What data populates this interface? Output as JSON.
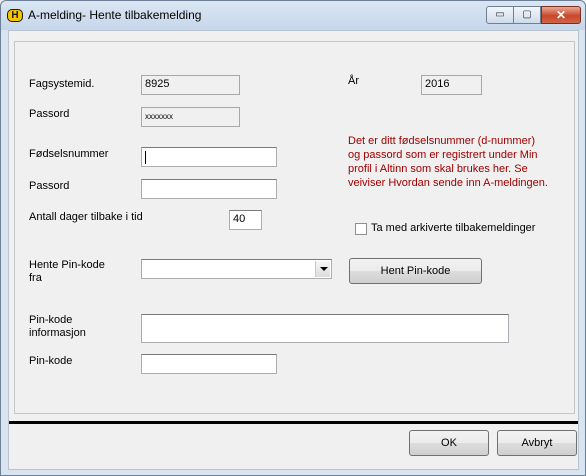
{
  "window": {
    "title": "A-melding- Hente tilbakemelding",
    "app_icon": "H",
    "controls": {
      "minimize": "▭",
      "maximize": "▢",
      "close": "✕"
    }
  },
  "form": {
    "fagsystemid_label": "Fagsystemid.",
    "fagsystemid_value": "8925",
    "ar_label": "År",
    "ar_value": "2016",
    "passord1_label": "Passord",
    "passord1_value": "xxxxxxx",
    "info_text": "Det er ditt fødselsnummer (d-nummer) og passord som er registrert under Min profil i Altinn som skal brukes her. Se veiviser Hvordan sende inn A-meldingen.",
    "fodselsnummer_label": "Fødselsnummer",
    "fodselsnummer_value": "",
    "passord2_label": "Passord",
    "passord2_value": "",
    "antall_dager_label": "Antall dager tilbake i tid",
    "antall_dager_value": "40",
    "arkiverte_label": "Ta med arkiverte tilbakemeldinger",
    "arkiverte_checked": false,
    "hente_pin_label_line1": "Hente Pin-kode",
    "hente_pin_label_line2": "fra",
    "hente_pin_selected": "",
    "hent_pin_button": "Hent Pin-kode",
    "pin_info_label_line1": "Pin-kode",
    "pin_info_label_line2": "informasjon",
    "pin_info_value": "",
    "pin_kode_label": "Pin-kode",
    "pin_kode_value": ""
  },
  "footer": {
    "ok_button": "OK",
    "avbryt_button": "Avbryt"
  }
}
